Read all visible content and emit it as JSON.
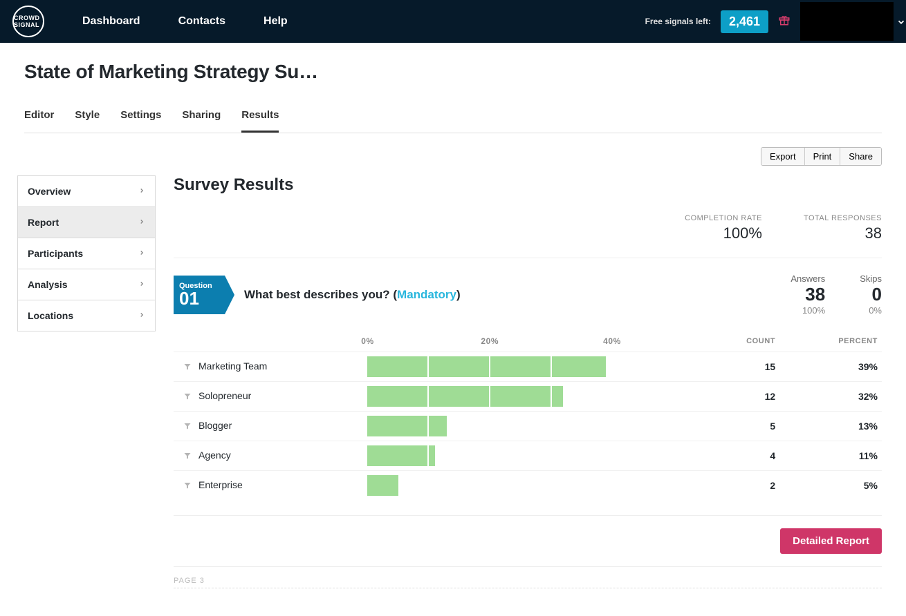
{
  "nav": {
    "logo_text": "CROWD SIGNAL",
    "items": [
      "Dashboard",
      "Contacts",
      "Help"
    ],
    "free_signals_label": "Free signals left:",
    "free_signals_value": "2,461"
  },
  "survey": {
    "title": "State of Marketing Strategy Su…"
  },
  "tabs": [
    "Editor",
    "Style",
    "Settings",
    "Sharing",
    "Results"
  ],
  "active_tab": "Results",
  "toolbar": {
    "export": "Export",
    "print": "Print",
    "share": "Share"
  },
  "sidebar": {
    "items": [
      "Overview",
      "Report",
      "Participants",
      "Analysis",
      "Locations"
    ],
    "active": "Report"
  },
  "results": {
    "heading": "Survey Results",
    "completion_label": "COMPLETION RATE",
    "completion_value": "100%",
    "total_label": "TOTAL RESPONSES",
    "total_value": "38"
  },
  "question": {
    "ribbon_label": "Question",
    "number": "01",
    "prefix": "What best describes you? (",
    "mandatory": "Mandatory",
    "suffix": ")",
    "answers_label": "Answers",
    "answers_val": "38",
    "answers_pct": "100%",
    "skips_label": "Skips",
    "skips_val": "0",
    "skips_pct": "0%"
  },
  "table": {
    "ticks": [
      "0%",
      "20%",
      "40%"
    ],
    "count_h": "COUNT",
    "percent_h": "PERCENT"
  },
  "chart_data": {
    "type": "bar",
    "categories": [
      "Marketing Team",
      "Solopreneur",
      "Blogger",
      "Agency",
      "Enterprise"
    ],
    "series": [
      {
        "name": "Count",
        "values": [
          15,
          12,
          5,
          4,
          2
        ]
      },
      {
        "name": "Percent",
        "values": [
          39,
          32,
          13,
          11,
          5
        ]
      }
    ],
    "xlim": [
      0,
      50
    ],
    "xlabel": "Percent"
  },
  "footer": {
    "detailed_button": "Detailed Report",
    "page_label": "PAGE 3"
  }
}
